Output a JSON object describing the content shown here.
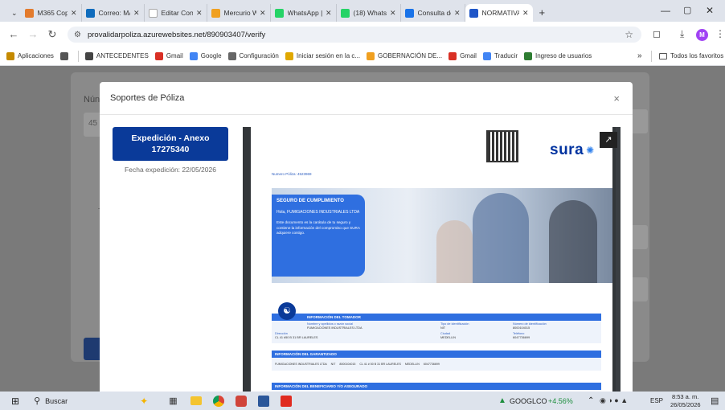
{
  "browser": {
    "tabs": [
      {
        "title": "M365 Copilo",
        "color": "#e37b2d"
      },
      {
        "title": "Correo: MAR",
        "color": "#0f6cbd"
      },
      {
        "title": "Editar Contr",
        "color": "#ffffff"
      },
      {
        "title": "Mercurio W",
        "color": "#f0a020"
      },
      {
        "title": "WhatsApp |",
        "color": "#25d366"
      },
      {
        "title": "(18) WhatsA",
        "color": "#25d366"
      },
      {
        "title": "Consulta de",
        "color": "#1a73e8"
      },
      {
        "title": "NORMATIVA",
        "color": "#1f56c8"
      }
    ],
    "new_tab": "+",
    "url": "provalidarpoliza.azurewebsites.net/890903407/verify",
    "profile_initial": "M",
    "bookmarks": [
      {
        "label": "Aplicaciones",
        "color": "#c58a00"
      },
      {
        "label": "",
        "color": "#555555"
      },
      {
        "label": "ANTECEDENTES",
        "color": "#444444"
      },
      {
        "label": "Gmail",
        "color": "#d93025"
      },
      {
        "label": "Google",
        "color": "#4285f4"
      },
      {
        "label": "Configuración",
        "color": "#666666"
      },
      {
        "label": "Iniciar sesión en la c...",
        "color": "#e0a800"
      },
      {
        "label": "GOBERNACIÓN DE...",
        "color": "#f0a020"
      },
      {
        "label": "Gmail",
        "color": "#d93025"
      },
      {
        "label": "Traducir",
        "color": "#4285f4"
      },
      {
        "label": "Ingreso de usuarios",
        "color": "#2e7d32"
      }
    ],
    "more_bookmarks": "»",
    "all_bookmarks": "Todos los favoritos"
  },
  "background": {
    "label_num": "Nún",
    "label_45": "45",
    "label_t": "T"
  },
  "modal": {
    "title": "Soportes de Póliza",
    "close": "×",
    "expedition_button": "Expedición - Anexo 17275340",
    "fecha": "Fecha expedición: 22/05/2026"
  },
  "document": {
    "brand": "sura",
    "policy_number": "Numero Póliza: 4523969",
    "banner_title": "SEGURO DE CUMPLIMIENTO",
    "greeting": "Hola, FUMIGACIONES INDUSTRIALES LTDA",
    "body": "Este documento es la carátula de tu seguro y contiene la información del compromiso que SURA adquiere contigo.",
    "section_tomador": "INFORMACIÓN DEL TOMADOR",
    "tomador_name_label": "Nombre y apellidos o razón social",
    "tomador_name": "FUMIGACIONES INDUSTRIALES LTDA",
    "tipo_id_label": "Tipo de identificación",
    "tipo_id": "NIT",
    "num_id_label": "Número de identificación",
    "num_id": "8000104015",
    "direccion_label": "Dirección",
    "direccion": "CL 41 #50 B 31 BR LAURELES",
    "ciudad_label": "Ciudad",
    "ciudad": "MEDELLIN",
    "telefono_label": "Teléfono",
    "telefono": "6047736699",
    "section_garantizado": "INFORMACIÓN DEL GARANTIZADO",
    "garantizado_row": "FUMIGACIONES INDUSTRIALES LTDA     NIT     8000104015     CL 41 # 50 B 31 BR LAURELES     MEDELLIN     6047736699",
    "section_beneficiario": "INFORMACIÓN DEL BENEFICIARIO Y/O ASEGURADO"
  },
  "taskbar": {
    "search": "Buscar",
    "stock_name": "GOOGLCO",
    "stock_change": "+4.56%",
    "lang": "ESP",
    "time": "8:53 a. m.",
    "date": "26/05/2026"
  },
  "colors": {
    "primary_blue": "#0a3a99",
    "sura_blue": "#0033a0",
    "sura_light": "#2f80ed",
    "up_green": "#1e8e3e"
  }
}
